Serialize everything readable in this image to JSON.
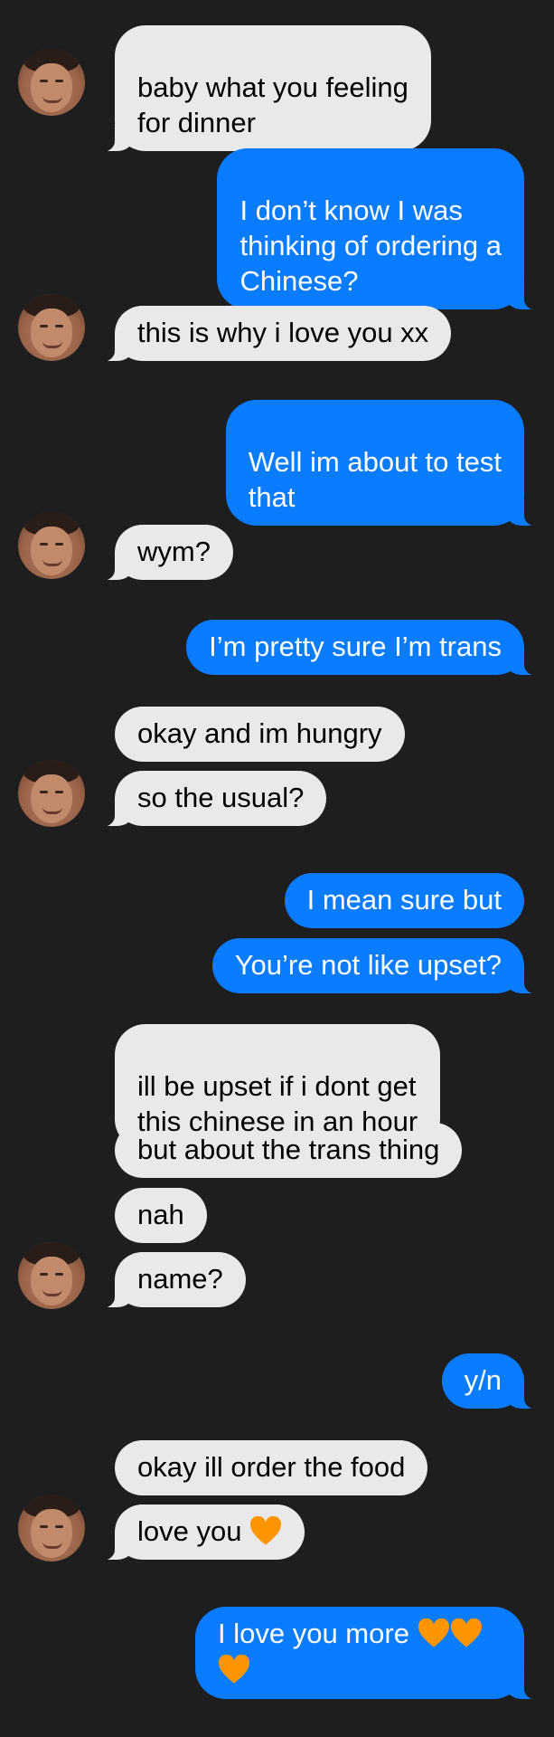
{
  "messages": [
    {
      "side": "in",
      "text": "baby what you feeling\nfor dinner"
    },
    {
      "side": "out",
      "text": "I don’t know I was\nthinking of ordering a\nChinese?"
    },
    {
      "side": "in",
      "text": "this is why i love you xx"
    },
    {
      "side": "out",
      "text": "Well im about to test\nthat"
    },
    {
      "side": "in",
      "text": "wym?"
    },
    {
      "side": "out",
      "text": "I’m pretty sure I’m trans"
    },
    {
      "side": "in",
      "text": "okay and im hungry"
    },
    {
      "side": "in",
      "text": "so the usual?"
    },
    {
      "side": "out",
      "text": "I mean sure but"
    },
    {
      "side": "out",
      "text": "You’re not like upset?"
    },
    {
      "side": "in",
      "text": "ill be upset if i dont get\nthis chinese in an hour"
    },
    {
      "side": "in",
      "text": "but about the trans thing"
    },
    {
      "side": "in",
      "text": "nah"
    },
    {
      "side": "in",
      "text": "name?"
    },
    {
      "side": "out",
      "text": "y/n"
    },
    {
      "side": "in",
      "text": "okay ill order the food"
    },
    {
      "side": "in",
      "text": "love you",
      "emoji": "orange-heart"
    },
    {
      "side": "out",
      "text": "I love you more",
      "emoji": "orange-heart x3"
    }
  ],
  "colors": {
    "background": "#1e1e1e",
    "incoming_bubble": "#e9e9eb",
    "outgoing_bubble": "#0a7cff",
    "heart": "#ff9500"
  },
  "icons": {
    "avatar": "contact-photo",
    "emoji": "orange-heart-icon"
  }
}
